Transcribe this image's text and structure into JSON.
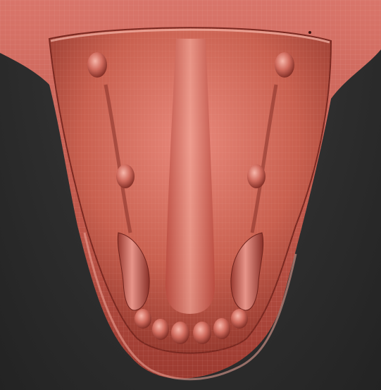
{
  "scene": {
    "background": "#2e2e2e",
    "colors": {
      "clay_light": "#e07c70",
      "clay_mid": "#c65a4f",
      "clay_dark": "#8a3028",
      "clay_shadow": "#5e1c16",
      "highlight": "#f3b0a4",
      "wire": "#f2c2b8"
    }
  }
}
